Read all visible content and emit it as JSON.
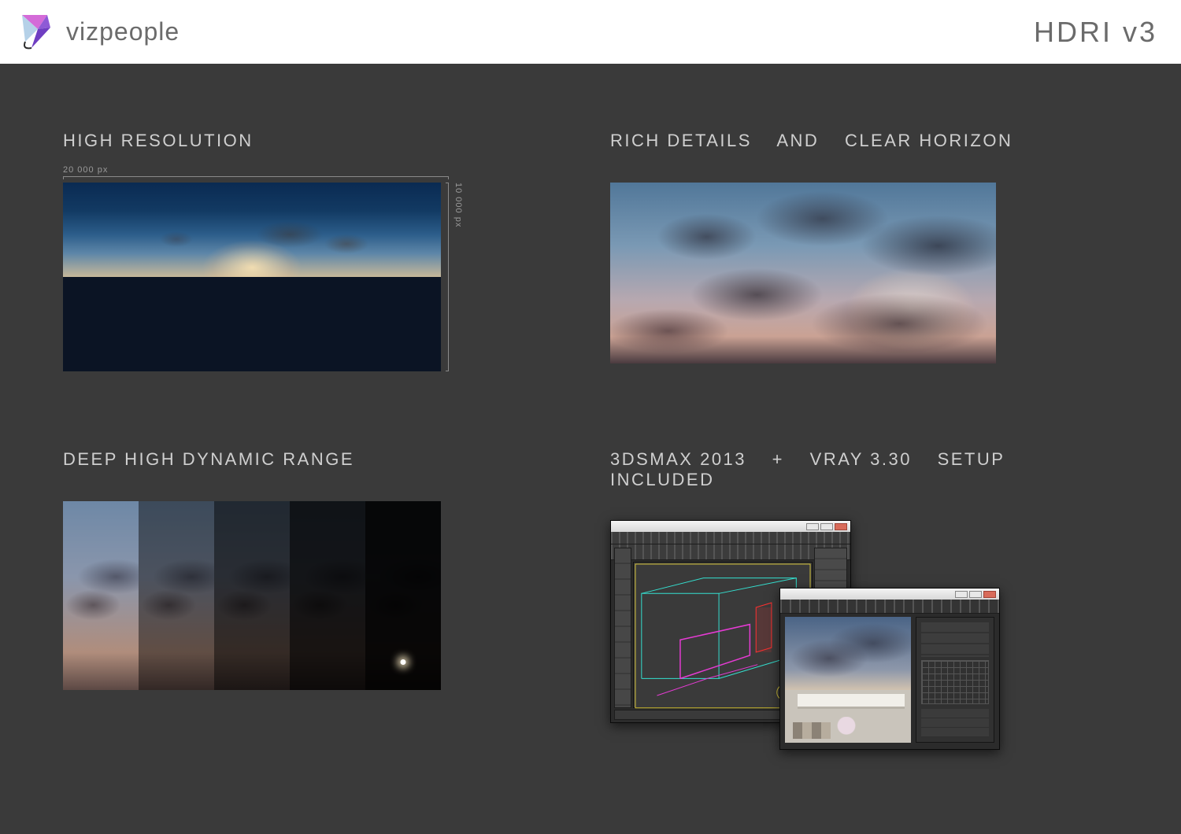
{
  "header": {
    "brand": "vizpeople",
    "product": "HDRI v3"
  },
  "sections": {
    "high_resolution": {
      "title": "HIGH RESOLUTION",
      "width_label": "20 000 px",
      "height_label": "10 000 px"
    },
    "rich_details": {
      "title_a": "RICH DETAILS",
      "title_sep": "AND",
      "title_b": "CLEAR HORIZON"
    },
    "dynamic_range": {
      "title": "DEEP HIGH DYNAMIC RANGE"
    },
    "setup": {
      "title_a": "3DSMAX 2013",
      "title_plus": "+",
      "title_b": "VRAY 3.30",
      "title_c": "SETUP INCLUDED"
    }
  }
}
